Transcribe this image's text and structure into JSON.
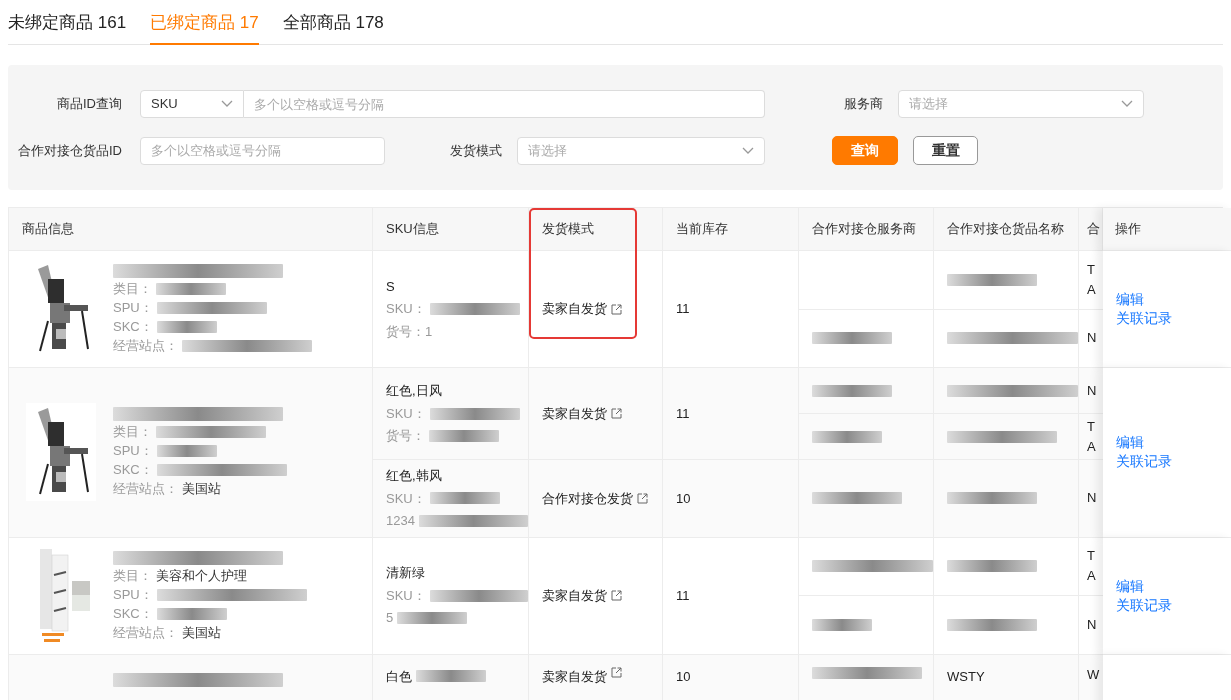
{
  "tabs": [
    {
      "label": "未绑定商品 161",
      "selected": false
    },
    {
      "label": "已绑定商品 17",
      "selected": true
    },
    {
      "label": "全部商品 178",
      "selected": false
    }
  ],
  "filters": {
    "id_query": {
      "label": "商品ID查询",
      "type_value": "SKU",
      "placeholder": "多个以空格或逗号分隔"
    },
    "provider": {
      "label": "服务商",
      "placeholder": "请选择"
    },
    "warehouse_id": {
      "label": "合作对接仓货品ID",
      "placeholder": "多个以空格或逗号分隔"
    },
    "shipping_mode": {
      "label": "发货模式",
      "placeholder": "请选择"
    },
    "buttons": [
      {
        "label": "查询",
        "kind": "primary"
      },
      {
        "label": "重置",
        "kind": "default"
      }
    ]
  },
  "table": {
    "columns": [
      {
        "label": "商品信息",
        "highlighted": false
      },
      {
        "label": "SKU信息",
        "highlighted": false
      },
      {
        "label": "发货模式",
        "highlighted": true
      },
      {
        "label": "当前库存",
        "highlighted": false
      },
      {
        "label": "合作对接仓服务商",
        "highlighted": false
      },
      {
        "label": "合作对接仓货品名称",
        "highlighted": false
      },
      {
        "label": "合",
        "highlighted": false
      },
      {
        "label": "操作",
        "highlighted": false
      }
    ],
    "rows": [
      {
        "picture": true,
        "title_redacted": true,
        "meta": [
          {
            "label": "类目：",
            "redacted": true
          },
          {
            "label": "SPU：",
            "redacted": true
          },
          {
            "label": "SKC：",
            "redacted": true
          },
          {
            "label": "经营站点：",
            "redacted": true
          }
        ],
        "skus": [
          {
            "lines": [
              {
                "text": "S",
                "redacted": false
              },
              {
                "text": "SKU：",
                "redacted": true
              },
              {
                "text": "货号：1",
                "redacted": false
              }
            ],
            "shipping": "卖家自发货",
            "stock": "11",
            "providers": [
              {
                "provider_redacted": false,
                "goods_redacted": true,
                "code": [
                  "T",
                  "A"
                ]
              },
              {
                "provider_redacted": true,
                "goods_redacted": true,
                "code": [
                  "N"
                ]
              }
            ]
          }
        ],
        "actions": [
          "编辑",
          "关联记录"
        ]
      },
      {
        "picture": true,
        "title_redacted": true,
        "meta": [
          {
            "label": "类目：",
            "redacted": true
          },
          {
            "label": "SPU：",
            "redacted": true
          },
          {
            "label": "SKC：",
            "redacted": true
          },
          {
            "label": "经营站点：",
            "value": "美国站",
            "redacted": false
          }
        ],
        "skus": [
          {
            "lines": [
              {
                "text": "红色,日风",
                "redacted": false
              },
              {
                "text": "SKU：",
                "redacted": true
              },
              {
                "text": "货号：",
                "redacted": true
              }
            ],
            "shipping": "卖家自发货",
            "stock": "11",
            "providers": [
              {
                "provider_redacted": true,
                "goods_redacted": true,
                "code": [
                  "N"
                ]
              },
              {
                "provider_redacted": true,
                "goods_redacted": true,
                "code": [
                  "T",
                  "A"
                ]
              }
            ]
          },
          {
            "lines": [
              {
                "text": "红色,韩风",
                "redacted": false
              },
              {
                "text": "SKU：",
                "redacted": true
              },
              {
                "text": "1234",
                "redacted": true
              }
            ],
            "shipping": "合作对接仓发货",
            "stock": "10",
            "providers": [
              {
                "provider_redacted": true,
                "goods_redacted": true,
                "code": [
                  "N"
                ]
              }
            ]
          }
        ],
        "actions": [
          "编辑",
          "关联记录"
        ]
      },
      {
        "picture": true,
        "title_redacted": true,
        "meta": [
          {
            "label": "类目：",
            "value": "美容和个人护理",
            "redacted": false
          },
          {
            "label": "SPU：",
            "redacted": true
          },
          {
            "label": "SKC：",
            "redacted": true
          },
          {
            "label": "经营站点：",
            "value": "美国站",
            "redacted": false
          }
        ],
        "skus": [
          {
            "lines": [
              {
                "text": "清新绿",
                "redacted": false
              },
              {
                "text": "SKU：",
                "redacted": true
              },
              {
                "text": "5",
                "redacted": true
              }
            ],
            "shipping": "卖家自发货",
            "stock": "11",
            "providers": [
              {
                "provider_redacted": true,
                "goods_redacted": true,
                "code": [
                  "T",
                  "A"
                ]
              },
              {
                "provider_redacted": true,
                "goods_redacted": true,
                "code": [
                  "N"
                ]
              }
            ]
          }
        ],
        "actions": [
          "编辑",
          "关联记录"
        ]
      },
      {
        "title_redacted": true,
        "meta": [],
        "skus": [
          {
            "lines": [
              {
                "text": "白色",
                "redacted": true
              }
            ],
            "shipping": "卖家自发货",
            "stock": "10",
            "providers": [
              {
                "provider_redacted": true,
                "goods": "WSTY",
                "goods_redacted": false,
                "code": [
                  "W"
                ]
              }
            ]
          }
        ],
        "actions": []
      }
    ]
  }
}
